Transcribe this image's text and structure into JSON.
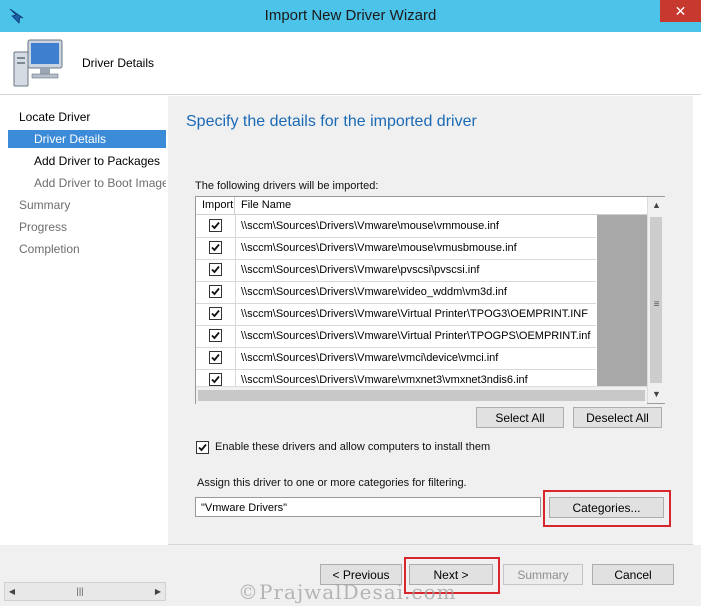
{
  "window": {
    "title": "Import New Driver Wizard",
    "close_glyph": "✕"
  },
  "header": {
    "label": "Driver Details"
  },
  "nav": {
    "items": [
      {
        "label": "Locate Driver",
        "state": "normal"
      },
      {
        "label": "Driver Details",
        "state": "selected"
      },
      {
        "label": "Add Driver to Packages",
        "state": "normal"
      },
      {
        "label": "Add Driver to Boot Image",
        "state": "grey"
      },
      {
        "label": "Summary",
        "state": "grey"
      },
      {
        "label": "Progress",
        "state": "grey"
      },
      {
        "label": "Completion",
        "state": "grey"
      }
    ]
  },
  "main": {
    "heading": "Specify the details for the imported driver",
    "table_caption": "The following drivers will be imported:",
    "columns": [
      "Import",
      "File Name"
    ],
    "rows": [
      {
        "checked": true,
        "file": "\\\\sccm\\Sources\\Drivers\\Vmware\\mouse\\vmmouse.inf"
      },
      {
        "checked": true,
        "file": "\\\\sccm\\Sources\\Drivers\\Vmware\\mouse\\vmusbmouse.inf"
      },
      {
        "checked": true,
        "file": "\\\\sccm\\Sources\\Drivers\\Vmware\\pvscsi\\pvscsi.inf"
      },
      {
        "checked": true,
        "file": "\\\\sccm\\Sources\\Drivers\\Vmware\\video_wddm\\vm3d.inf"
      },
      {
        "checked": true,
        "file": "\\\\sccm\\Sources\\Drivers\\Vmware\\Virtual Printer\\TPOG3\\OEMPRINT.INF"
      },
      {
        "checked": true,
        "file": "\\\\sccm\\Sources\\Drivers\\Vmware\\Virtual Printer\\TPOGPS\\OEMPRINT.inf"
      },
      {
        "checked": true,
        "file": "\\\\sccm\\Sources\\Drivers\\Vmware\\vmci\\device\\vmci.inf"
      },
      {
        "checked": true,
        "file": "\\\\sccm\\Sources\\Drivers\\Vmware\\vmxnet3\\vmxnet3ndis6.inf"
      }
    ],
    "select_all": "Select All",
    "deselect_all": "Deselect All",
    "enable_label": "Enable these drivers and allow computers to install them",
    "enable_checked": true,
    "categories_caption": "Assign this driver to one or more categories for filtering.",
    "categories_value": "\"Vmware Drivers\"",
    "categories_button": "Categories..."
  },
  "footer": {
    "previous": "< Previous",
    "next": "Next >",
    "summary": "Summary",
    "cancel": "Cancel"
  },
  "watermark": "©PrajwalDesai.com",
  "colors": {
    "titlebar": "#4cc3e8",
    "selection": "#3c8bd8",
    "heading": "#1a6ab6",
    "highlight": "#d9252c"
  }
}
